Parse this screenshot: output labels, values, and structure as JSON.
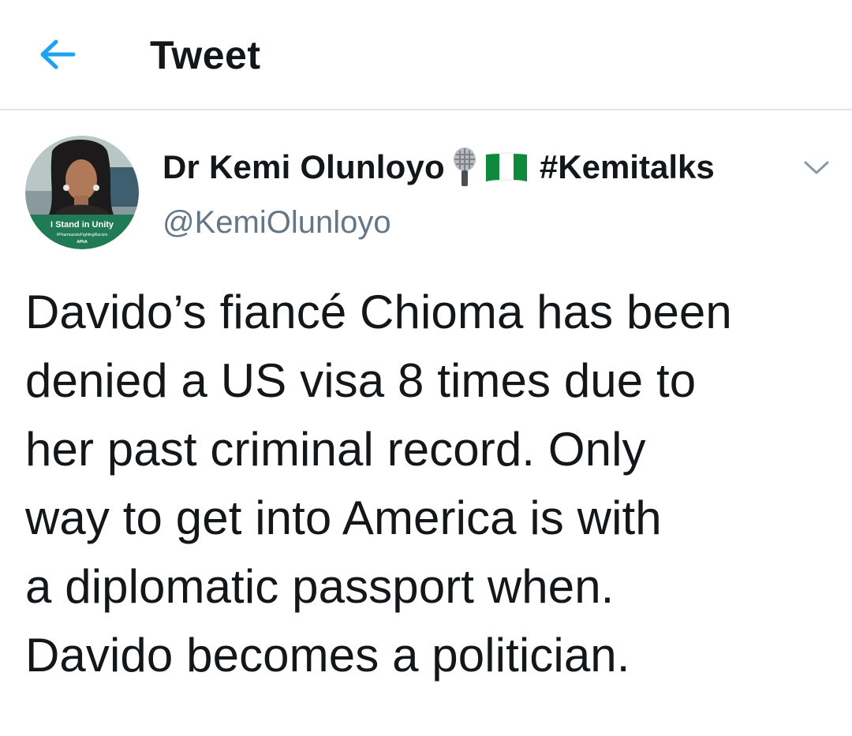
{
  "header": {
    "title": "Tweet",
    "back_icon": "arrow-left-icon",
    "accent_color": "#1da1f2"
  },
  "tweet": {
    "author": {
      "display_name": "Dr Kemi Olunloyo",
      "emojis": [
        "microphone-emoji",
        "nigeria-flag-emoji"
      ],
      "name_suffix": "#Kemitalks",
      "handle": "@KemiOlunloyo",
      "avatar_badge": {
        "line1": "I Stand in Unity",
        "line2": "#PharmacistsFightingRacism",
        "line3": "APhA"
      }
    },
    "menu_icon": "chevron-down-icon",
    "lines": [
      "Davido’s fiancé Chioma has been",
      "denied a US visa 8 times due to",
      "her past criminal record. Only",
      "way to get into America is with",
      "a diplomatic passport when.",
      "Davido becomes a politician."
    ]
  },
  "colors": {
    "text": "#14171a",
    "secondary": "#657786",
    "divider": "#e1e8ed",
    "badge_green": "#1f7a55"
  }
}
